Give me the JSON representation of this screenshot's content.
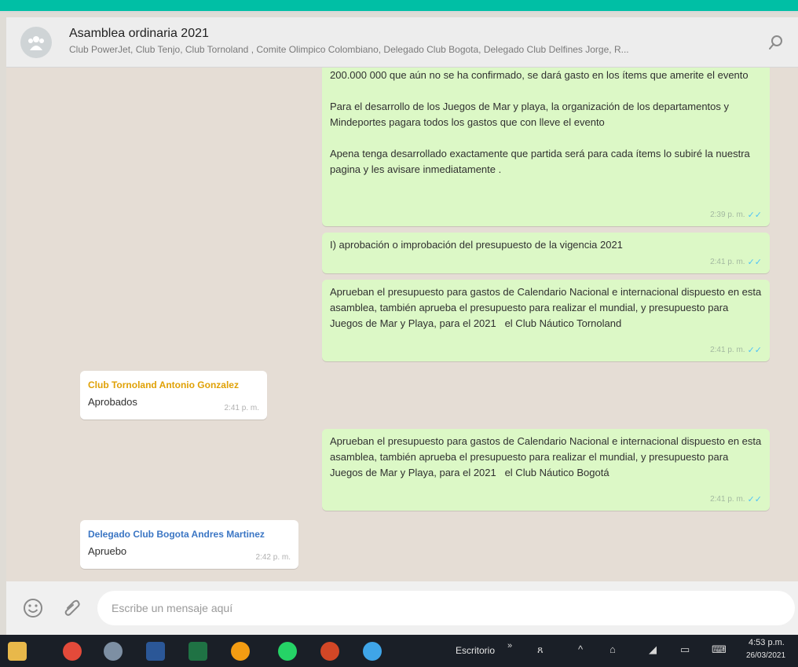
{
  "header": {
    "title": "Asamblea ordinaria 2021",
    "participants": "Club PowerJet, Club Tenjo, Club Tornoland , Comite Olimpico Colombiano, Delegado Club Bogota, Delegado Club Delfines Jorge, R..."
  },
  "messages": [
    {
      "type": "out",
      "text": "200.000 000 que aún no se ha confirmado, se dará gasto en los ítems que amerite el evento\n\nPara el desarrollo de los Juegos de Mar y playa, la organización de los departamentos y Mindeportes pagara todos los gastos que con lleve el evento\n\nApena tenga desarrollado exactamente que partida será para cada ítems lo subiré la nuestra pagina y les avisare inmediatamente .",
      "time": "2:39 p. m."
    },
    {
      "type": "out",
      "text": "I) aprobación o improbación del presupuesto de la vigencia 2021",
      "time": "2:41 p. m."
    },
    {
      "type": "out",
      "text": "Aprueban el presupuesto para gastos de Calendario Nacional e internacional dispuesto en esta asamblea, también aprueba el presupuesto para realizar el mundial, y presupuesto para Juegos de Mar y Playa, para el 2021   el Club Náutico Tornoland",
      "time": "2:41 p. m."
    },
    {
      "type": "in",
      "sender": "Club Tornoland Antonio Gonzalez",
      "sender_color": "#e0a106",
      "text": "Aprobados",
      "time": "2:41 p. m."
    },
    {
      "type": "out",
      "text": "Aprueban el presupuesto para gastos de Calendario Nacional e internacional dispuesto en esta asamblea, también aprueba el presupuesto para realizar el mundial, y presupuesto para Juegos de Mar y Playa, para el 2021   el Club Náutico Bogotá",
      "time": "2:41 p. m."
    },
    {
      "type": "in",
      "sender": "Delegado Club Bogota Andres Martinez",
      "sender_color": "#3b76c4",
      "text": "Apruebo",
      "time": "2:42 p. m."
    }
  ],
  "compose": {
    "placeholder": "Escribe un mensaje aquí"
  },
  "taskbar": {
    "desktop_label": "Escritorio",
    "clock_time": "4:53 p.m.",
    "clock_date": "26/03/2021"
  },
  "colors": {
    "accent": "#00bfa5",
    "outgoing_bubble": "#dcf8c6",
    "incoming_bubble": "#ffffff",
    "chat_background": "#e5ddd5",
    "taskbar": "#1a1f27"
  },
  "icons": {
    "avatar": "group-avatar-icon",
    "search": "search-icon",
    "emoji": "emoji-icon",
    "attach": "paperclip-icon",
    "ticks": "double-check-icon"
  }
}
